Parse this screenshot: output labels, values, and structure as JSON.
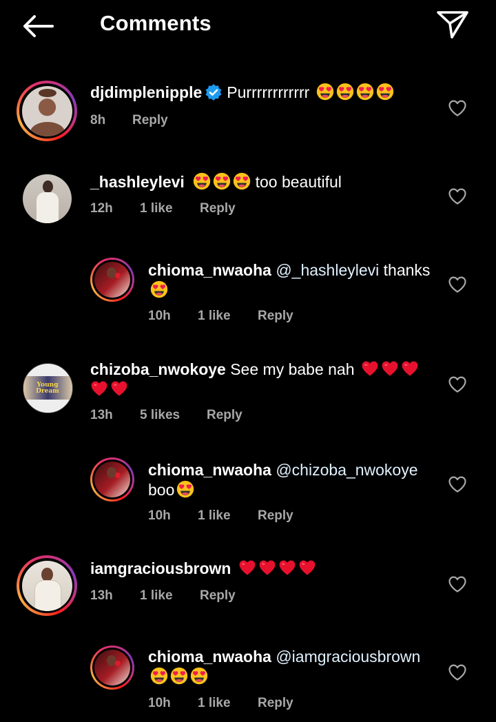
{
  "header": {
    "title": "Comments",
    "back_icon": "arrow-left-icon",
    "share_icon": "paper-plane-icon"
  },
  "colors": {
    "background": "#000000",
    "meta_text": "#a8a8a8",
    "mention": "#e0f1ff",
    "verified": "#1d9bf0",
    "heart_emoji": "#e8112d"
  },
  "comments": [
    {
      "username": "djdimplenipple",
      "verified": true,
      "text": "Purrrrrrrrrrrr",
      "emojis": [
        "heart-eyes",
        "heart-eyes",
        "heart-eyes",
        "heart-eyes"
      ],
      "time": "8h",
      "likes": "",
      "reply_label": "Reply"
    },
    {
      "username": "_hashleylevi",
      "text_after": "too beautiful",
      "emojis_before": [
        "heart-eyes",
        "heart-eyes",
        "heart-eyes"
      ],
      "time": "12h",
      "likes": "1 like",
      "reply_label": "Reply"
    },
    {
      "username": "chioma_nwaoha",
      "mention": "@_hashleylevi",
      "text": "thanks",
      "emojis": [
        "heart-eyes"
      ],
      "time": "10h",
      "likes": "1 like",
      "reply_label": "Reply",
      "is_reply": true
    },
    {
      "username": "chizoba_nwokoye",
      "text": "See my babe nah",
      "emojis": [
        "red-heart",
        "red-heart",
        "red-heart",
        "red-heart",
        "red-heart"
      ],
      "time": "13h",
      "likes": "5 likes",
      "reply_label": "Reply",
      "avatar_text": "Young Dream"
    },
    {
      "username": "chioma_nwaoha",
      "mention": "@chizoba_nwokoye",
      "text": "boo",
      "emojis": [
        "heart-eyes"
      ],
      "time": "10h",
      "likes": "1 like",
      "reply_label": "Reply",
      "is_reply": true
    },
    {
      "username": "iamgraciousbrown",
      "emojis": [
        "red-heart",
        "red-heart",
        "red-heart",
        "red-heart"
      ],
      "time": "13h",
      "likes": "1 like",
      "reply_label": "Reply"
    },
    {
      "username": "chioma_nwaoha",
      "mention": "@iamgraciousbrown",
      "emojis": [
        "heart-eyes",
        "heart-eyes",
        "heart-eyes"
      ],
      "time": "10h",
      "likes": "1 like",
      "reply_label": "Reply",
      "is_reply": true
    }
  ]
}
